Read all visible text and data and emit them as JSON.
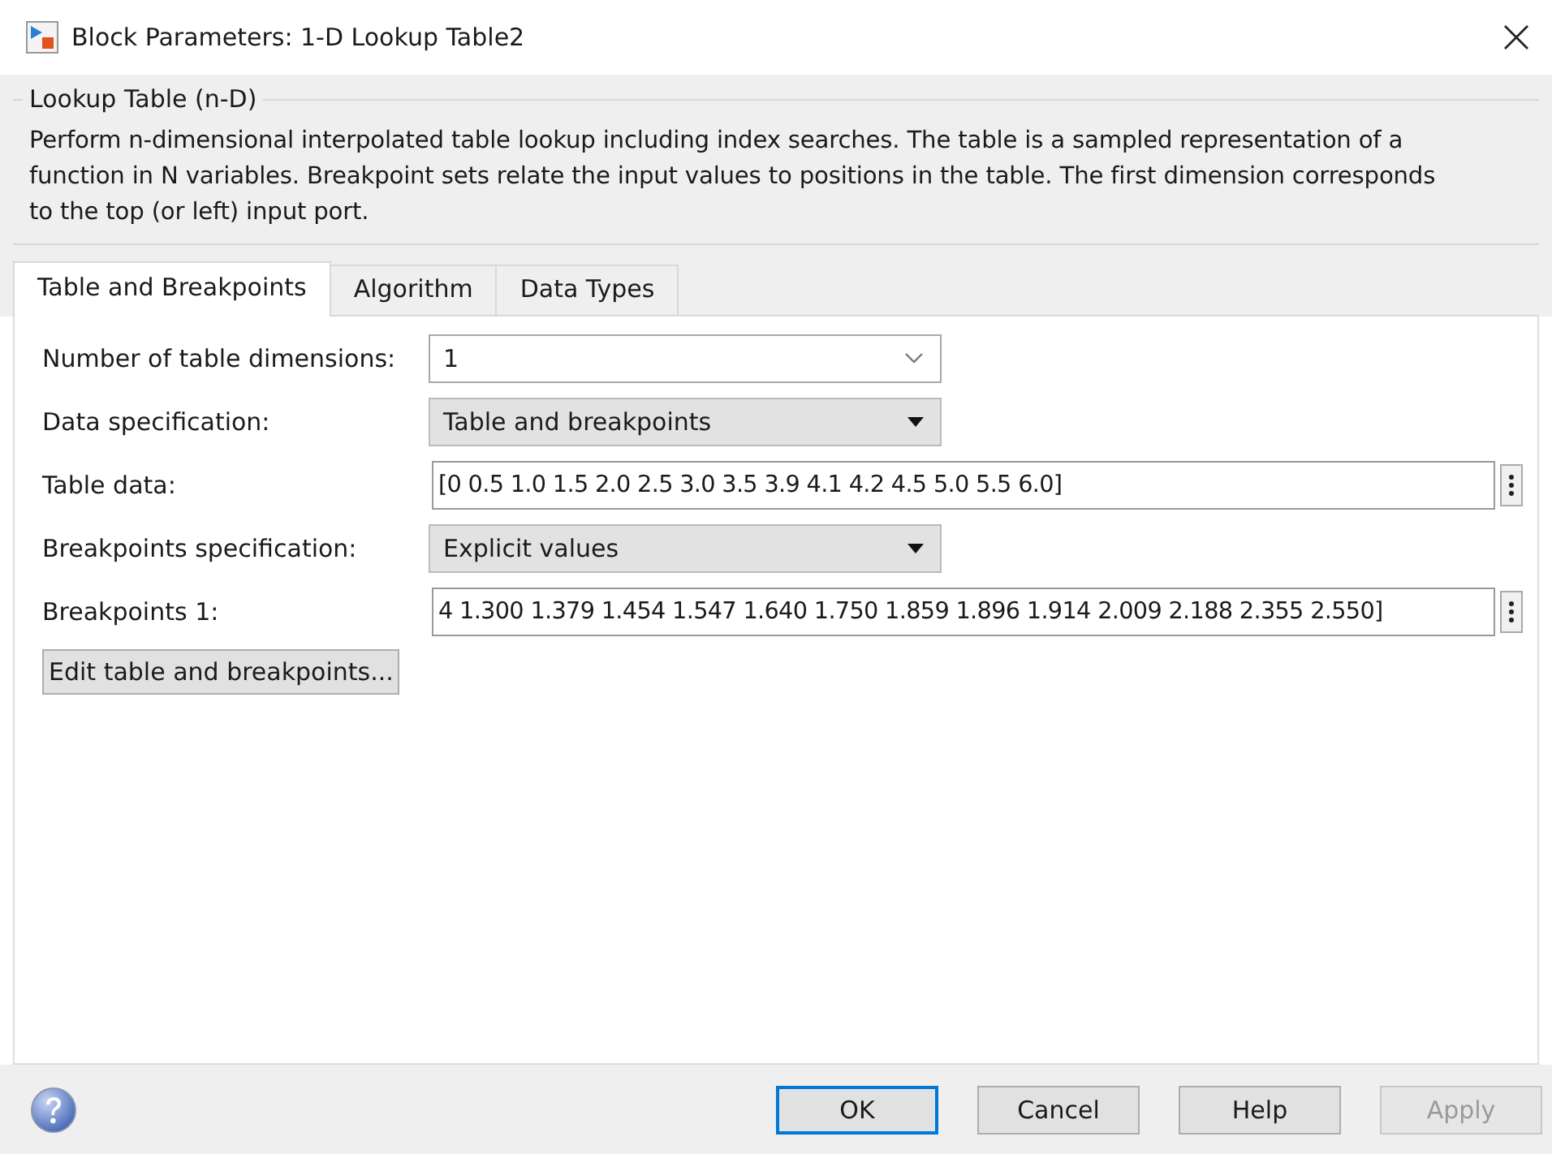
{
  "window": {
    "title": "Block Parameters: 1-D Lookup Table2"
  },
  "group": {
    "title": "Lookup Table (n-D)",
    "description": "Perform n-dimensional interpolated table lookup including index searches. The table is a sampled representation of a function in N variables. Breakpoint sets relate the input values to positions in the table. The first dimension corresponds to the top (or left) input port."
  },
  "tabs": [
    {
      "label": "Table and Breakpoints",
      "selected": true
    },
    {
      "label": "Algorithm",
      "selected": false
    },
    {
      "label": "Data Types",
      "selected": false
    }
  ],
  "parameters": [
    {
      "label": "Number of table dimensions:",
      "kind": "combo",
      "value": "1"
    },
    {
      "label": "Data specification:",
      "kind": "dropdown",
      "value": "Table and breakpoints"
    },
    {
      "label": "Table data:",
      "kind": "text",
      "value": "[0 0.5 1.0 1.5 2.0 2.5 3.0 3.5 3.9 4.1 4.2 4.5 5.0 5.5 6.0]"
    },
    {
      "label": "Breakpoints specification:",
      "kind": "dropdown",
      "value": "Explicit values"
    },
    {
      "label": "Breakpoints 1:",
      "kind": "text",
      "value": "4 1.300 1.379 1.454 1.547 1.640 1.750 1.859 1.896 1.914 2.009 2.188 2.355 2.550]"
    }
  ],
  "edit_button": "Edit table and breakpoints...",
  "buttons": [
    {
      "label": "OK",
      "default": true,
      "disabled": false
    },
    {
      "label": "Cancel",
      "default": false,
      "disabled": false
    },
    {
      "label": "Help",
      "default": false,
      "disabled": false
    },
    {
      "label": "Apply",
      "default": false,
      "disabled": true
    }
  ]
}
